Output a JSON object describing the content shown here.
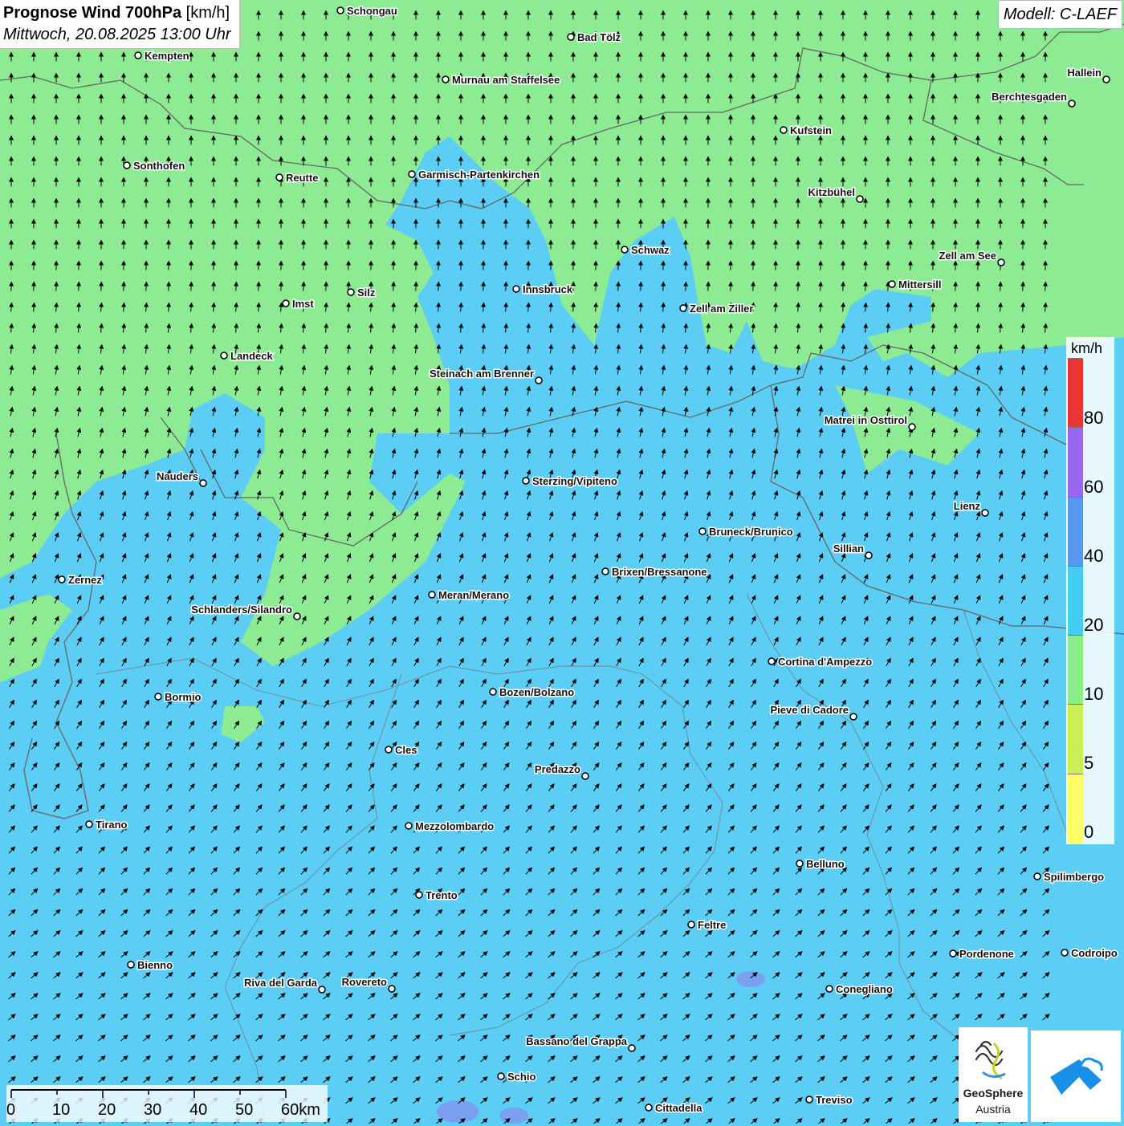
{
  "title": {
    "main": "Prognose Wind 700hPa",
    "unit": "[km/h]",
    "datetime": "Mittwoch, 20.08.2025 13:00 Uhr"
  },
  "model": "Modell: C-LAEF",
  "legend": {
    "unit": "km/h",
    "labels": [
      "80",
      "60",
      "40",
      "20",
      "10",
      "5",
      "0"
    ],
    "colors": [
      "#ee3333",
      "#9966ee",
      "#5599ee",
      "#44ccf5",
      "#88ee88",
      "#ccee55",
      "#ffff66"
    ]
  },
  "scale_bar": {
    "labels": [
      "0",
      "10",
      "20",
      "30",
      "40",
      "50",
      "60km"
    ]
  },
  "logo": {
    "name": "GeoSphere",
    "sub": "Austria"
  },
  "cities": [
    {
      "name": "Schongau"
    },
    {
      "name": "Bad Tölz"
    },
    {
      "name": "Kempten"
    },
    {
      "name": "Murnau am Staffelsee"
    },
    {
      "name": "Hallein"
    },
    {
      "name": "Berchtesgaden"
    },
    {
      "name": "Kufstein"
    },
    {
      "name": "Sonthofen"
    },
    {
      "name": "Reutte"
    },
    {
      "name": "Garmisch-Partenkirchen"
    },
    {
      "name": "Kitzbühel"
    },
    {
      "name": "Schwaz"
    },
    {
      "name": "Zell am See"
    },
    {
      "name": "Mittersill"
    },
    {
      "name": "Innsbruck"
    },
    {
      "name": "Silz"
    },
    {
      "name": "Imst"
    },
    {
      "name": "Zell am Ziller"
    },
    {
      "name": "Landeck"
    },
    {
      "name": "Steinach am Brenner"
    },
    {
      "name": "Matrei in Osttirol"
    },
    {
      "name": "Nauders"
    },
    {
      "name": "Sterzing/Vipiteno"
    },
    {
      "name": "Lienz"
    },
    {
      "name": "Bruneck/Brunico"
    },
    {
      "name": "Sillian"
    },
    {
      "name": "Brixen/Bressanone"
    },
    {
      "name": "Zernez"
    },
    {
      "name": "Meran/Merano"
    },
    {
      "name": "Schlanders/Silandro"
    },
    {
      "name": "Cortina d'Ampezzo"
    },
    {
      "name": "Bozen/Bolzano"
    },
    {
      "name": "Bormio"
    },
    {
      "name": "Pieve di Cadore"
    },
    {
      "name": "Cles"
    },
    {
      "name": "Predazzo"
    },
    {
      "name": "Tirano"
    },
    {
      "name": "Mezzolombardo"
    },
    {
      "name": "Belluno"
    },
    {
      "name": "Spilimbergo"
    },
    {
      "name": "Trento"
    },
    {
      "name": "Feltre"
    },
    {
      "name": "Pordenone"
    },
    {
      "name": "Codroipo"
    },
    {
      "name": "Bienno"
    },
    {
      "name": "Riva del Garda"
    },
    {
      "name": "Rovereto"
    },
    {
      "name": "Conegliano"
    },
    {
      "name": "Bassano del Grappa"
    },
    {
      "name": "Schio"
    },
    {
      "name": "Treviso"
    },
    {
      "name": "Cittadella"
    }
  ]
}
